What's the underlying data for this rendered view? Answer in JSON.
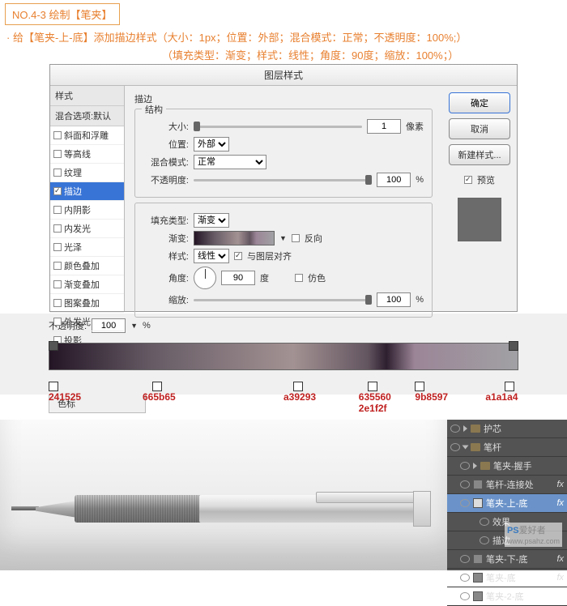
{
  "header": {
    "section_no": "NO.4-3 绘制【笔夹】",
    "desc1": "· 给【笔夹-上-底】添加描边样式（大小：1px；位置：外部；混合模式：正常；不透明度：100%;）",
    "desc2": "（填充类型：渐变；样式：线性；角度：90度；缩放：100%；）"
  },
  "dialog": {
    "title": "图层样式",
    "styles_header": "样式",
    "blend_default": "混合选项:默认",
    "list": [
      "斜面和浮雕",
      "等高线",
      "纹理",
      "描边",
      "内阴影",
      "内发光",
      "光泽",
      "颜色叠加",
      "渐变叠加",
      "图案叠加",
      "外发光",
      "投影"
    ],
    "stroke_label": "描边",
    "structure_label": "结构",
    "size_label": "大小:",
    "size_value": "1",
    "size_unit": "像素",
    "position_label": "位置:",
    "position_value": "外部",
    "blend_label": "混合模式:",
    "blend_value": "正常",
    "opacity_label": "不透明度:",
    "opacity_value": "100",
    "percent": "%",
    "fill_type_label": "填充类型:",
    "fill_type_value": "渐变",
    "gradient_label": "渐变:",
    "reverse_label": "反向",
    "align_label": "与图层对齐",
    "style_label": "样式:",
    "style_value": "线性",
    "angle_label": "角度:",
    "angle_value": "90",
    "angle_unit": "度",
    "dither_label": "仿色",
    "scale_label": "缩放:",
    "scale_value": "100",
    "btn_ok": "确定",
    "btn_cancel": "取消",
    "btn_new": "新建样式...",
    "preview_label": "预览"
  },
  "gradient": {
    "opacity_label": "不透明度:",
    "opacity_value": "100",
    "stops": [
      {
        "pos": 0,
        "color": "241525"
      },
      {
        "pos": 22,
        "color": "665b65"
      },
      {
        "pos": 52,
        "color": "a39293"
      },
      {
        "pos": 68,
        "color": "635560"
      },
      {
        "pos": 72,
        "color": "2e1f2f"
      },
      {
        "pos": 78,
        "color": "9b8597"
      },
      {
        "pos": 97,
        "color": "a1a1a4"
      }
    ],
    "se_label": "色标"
  },
  "layers": {
    "items": [
      {
        "name": "护芯",
        "type": "folder"
      },
      {
        "name": "笔杆",
        "type": "folder-open"
      },
      {
        "name": "笔夹-握手",
        "type": "folder"
      },
      {
        "name": "笔杆-连接处",
        "type": "layer",
        "fx": true
      },
      {
        "name": "笔夹-上-底",
        "type": "layer-sel",
        "fx": true
      },
      {
        "name": "效果",
        "type": "fx-head"
      },
      {
        "name": "描边",
        "type": "fx-item"
      },
      {
        "name": "笔夹-下-底",
        "type": "layer",
        "fx": true
      },
      {
        "name": "笔夹-底",
        "type": "layer",
        "fx": true
      },
      {
        "name": "笔夹-2-底",
        "type": "layer"
      }
    ]
  },
  "watermark": {
    "brand": "PS",
    "name": "爱好者",
    "url": "www.psahz.com"
  }
}
